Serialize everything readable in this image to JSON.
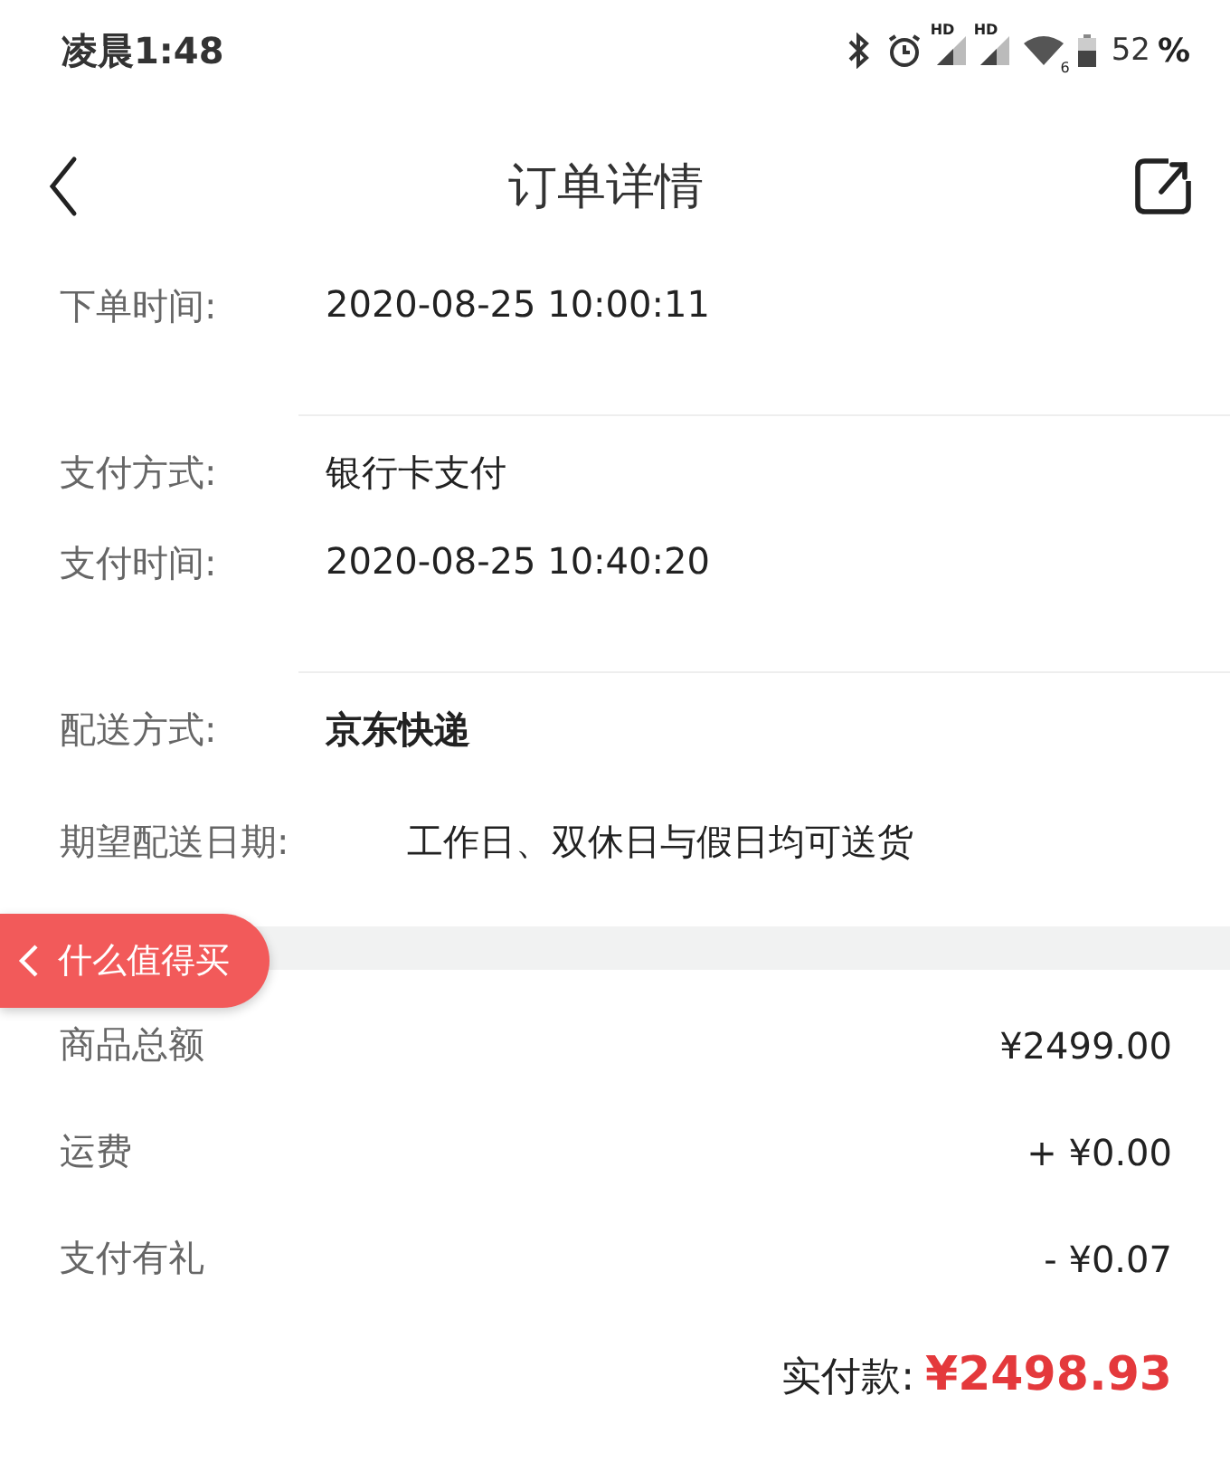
{
  "status_bar": {
    "time": "凌晨1:48",
    "battery_percent": "52",
    "percent_sign": "%",
    "wifi_badge": "6",
    "signal_badges": [
      "HD",
      "HD"
    ]
  },
  "header": {
    "title": "订单详情"
  },
  "order_info": [
    {
      "label": "下单时间:",
      "value": "2020-08-25 10:00:11",
      "kind": "plain",
      "divider": true
    },
    {
      "label": "支付方式:",
      "value": "银行卡支付",
      "kind": "plain",
      "divider": false
    },
    {
      "label": "支付时间:",
      "value": "2020-08-25 10:40:20",
      "kind": "plain",
      "divider": true
    },
    {
      "label": "配送方式:",
      "value": "京东快递",
      "kind": "bold",
      "divider": false
    },
    {
      "label": "期望配送日期:",
      "value": "工作日、双休日与假日均可送货",
      "kind": "wide",
      "divider": false
    }
  ],
  "floating_button": {
    "label": "什么值得买"
  },
  "amounts": [
    {
      "label": "商品总额",
      "value": "¥2499.00"
    },
    {
      "label": "运费",
      "value": "+ ¥0.00"
    },
    {
      "label": "支付有礼",
      "value": "- ¥0.07"
    }
  ],
  "total": {
    "label": "实付款:",
    "value": "¥2498.93"
  }
}
